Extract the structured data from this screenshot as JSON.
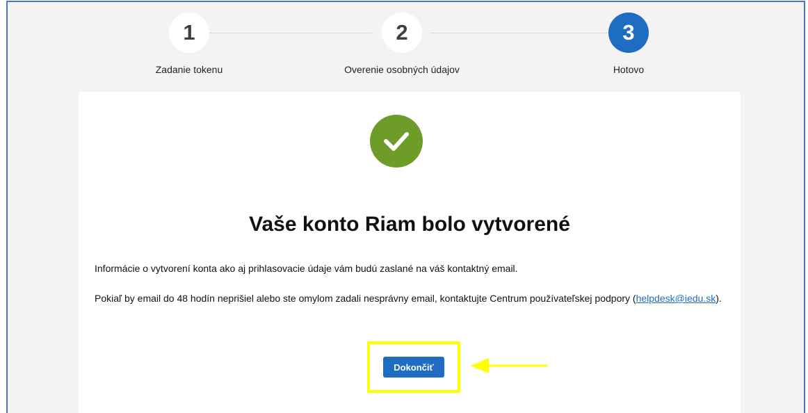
{
  "stepper": {
    "steps": [
      {
        "number": "1",
        "label": "Zadanie tokenu"
      },
      {
        "number": "2",
        "label": "Overenie osobných údajov"
      },
      {
        "number": "3",
        "label": "Hotovo"
      }
    ],
    "active_step": 3
  },
  "card": {
    "title": "Vaše konto Riam bolo vytvorené",
    "info_text": "Informácie o vytvorení konta ako aj prihlasovacie údaje vám budú zaslané na váš kontaktný email.",
    "support_text_before": "Pokiaľ by email do 48 hodín neprišiel alebo ste omylom zadali nesprávny email, kontaktujte Centrum používateľskej podpory (",
    "support_email": "helpdesk@iedu.sk",
    "support_text_after": ").",
    "finish_button_label": "Dokončiť"
  },
  "icons": {
    "success": "check-icon",
    "annotation": "arrow-left-icon"
  },
  "colors": {
    "primary": "#1f6dc2",
    "success": "#6e9c29",
    "highlight": "#ffff00",
    "frame_border": "#4a73c9",
    "background": "#f3f3f3"
  }
}
